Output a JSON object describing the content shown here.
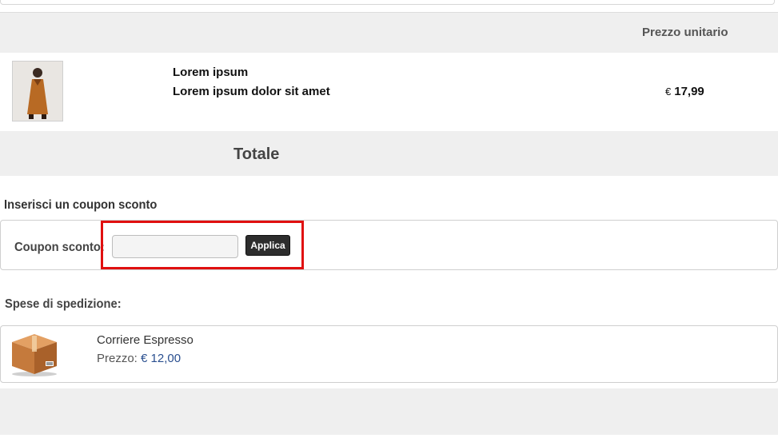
{
  "table": {
    "header_price": "Prezzo unitario"
  },
  "product": {
    "name_line1": "Lorem ipsum",
    "name_line2": "Lorem ipsum dolor sit amet",
    "currency": "€",
    "price": "17,99"
  },
  "totals": {
    "label": "Totale"
  },
  "coupon": {
    "title": "Inserisci un coupon sconto",
    "label": "Coupon sconto:",
    "input_value": "",
    "apply_label": "Applica",
    "highlight_color": "#e01010"
  },
  "shipping": {
    "title": "Spese di spedizione:",
    "method_name": "Corriere Espresso",
    "price_label": "Prezzo:",
    "price_value": "€ 12,00",
    "icon": "package-box-icon"
  },
  "colors": {
    "panel_gray": "#efefef",
    "button_dark": "#2d2d2d",
    "price_blue": "#2a4f8f"
  }
}
